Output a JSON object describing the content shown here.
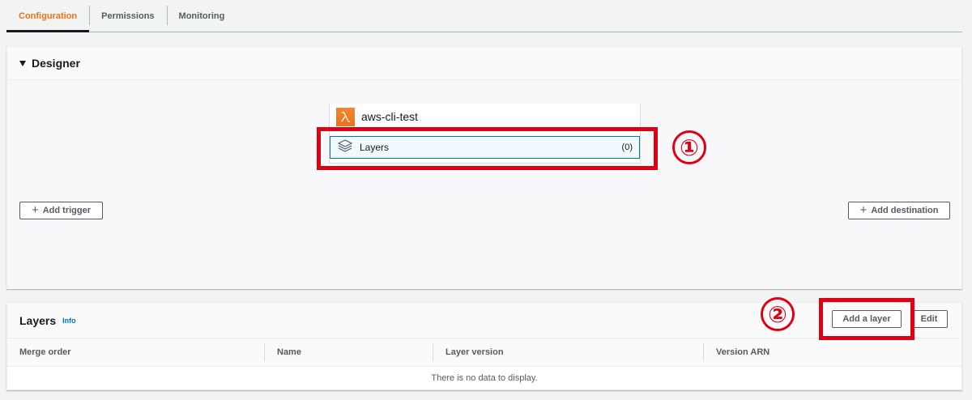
{
  "tabs": [
    {
      "label": "Configuration",
      "active": true
    },
    {
      "label": "Permissions",
      "active": false
    },
    {
      "label": "Monitoring",
      "active": false
    }
  ],
  "designer": {
    "title": "Designer",
    "function_name": "aws-cli-test",
    "layers_label": "Layers",
    "layers_count": "(0)",
    "add_trigger": "Add trigger",
    "add_destination": "Add destination"
  },
  "annotations": {
    "marker_1": "①",
    "marker_2": "②",
    "color": "#e00014"
  },
  "layers_section": {
    "title": "Layers",
    "info": "Info",
    "add_layer": "Add a layer",
    "edit": "Edit",
    "columns": [
      "Merge order",
      "Name",
      "Layer version",
      "Version ARN"
    ],
    "empty_message": "There is no data to display."
  },
  "colors": {
    "accent": "#ec7211",
    "link": "#0073bb",
    "lambda": "#f58534"
  },
  "icons": {
    "lambda": "lambda-icon",
    "layers": "layers-icon",
    "plus": "plus-icon",
    "caret": "caret-down-icon"
  }
}
